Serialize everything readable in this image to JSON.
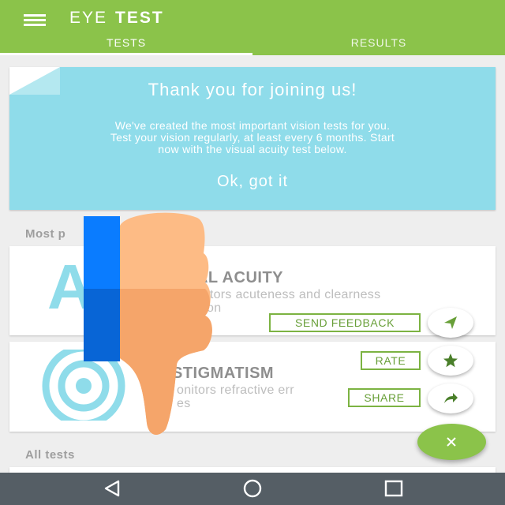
{
  "app": {
    "title_light": "EYE",
    "title_bold": "TEST"
  },
  "tabs": [
    {
      "label": "TESTS",
      "selected": true
    },
    {
      "label": "RESULTS",
      "selected": false
    }
  ],
  "welcome": {
    "title": "Thank you for joining us!",
    "body_line1": "We've created the most important vision tests for you.",
    "body_line2": "Test your vision regularly, at least every 6 months. Start",
    "body_line3": "now with the visual acuity test below.",
    "ok_label": "Ok, got it"
  },
  "sections": {
    "most_popular": "Most p",
    "all_tests": "All tests"
  },
  "cards": [
    {
      "title": "UAL ACUITY",
      "desc_line1": "itors acuteness and clearness",
      "desc_line2": "on",
      "icon_letter": "A"
    },
    {
      "title": "STIGMATISM",
      "desc_line1": "onitors refractive err",
      "desc_line2": "es"
    }
  ],
  "fab_menu": {
    "send_feedback": "SEND FEEDBACK",
    "rate": "RATE",
    "share": "SHARE"
  },
  "colors": {
    "primary": "#8bc34a",
    "welcome_bg": "#8fdcea",
    "accent_cyan": "#8fdcea",
    "navbar": "#555e65"
  },
  "icons": {
    "menu": "hamburger-menu-icon",
    "send": "send-icon",
    "rate": "star-icon",
    "share": "share-icon",
    "close": "close-icon",
    "nav_back": "back-triangle-icon",
    "nav_home": "home-circle-icon",
    "nav_recents": "recents-square-icon",
    "overlay": "thumbs-down-icon"
  }
}
